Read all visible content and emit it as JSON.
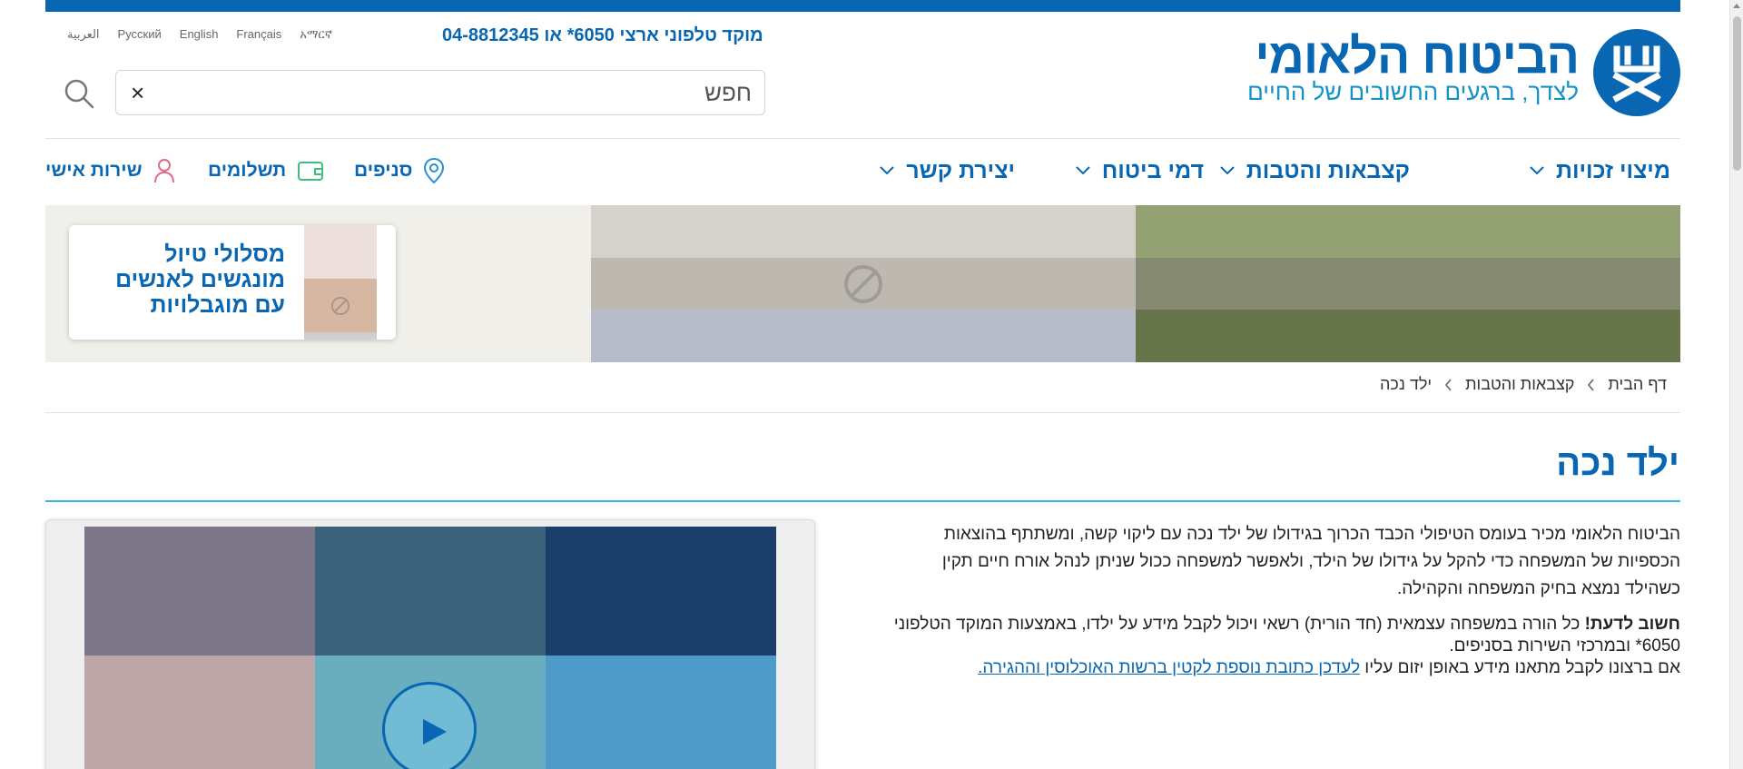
{
  "brand": {
    "title": "הביטוח הלאומי",
    "slogan": "לצדך, ברגעים החשובים של החיים",
    "color": "#0866b2"
  },
  "languages": [
    "العربية",
    "Русский",
    "English",
    "Français",
    "አማርኛ"
  ],
  "hotline": "מוקד טלפוני ארצי 6050* או 04-8812345",
  "search": {
    "placeholder": "חפש",
    "clear_label": "×"
  },
  "nav": {
    "main": [
      {
        "label": "מיצוי זכויות"
      },
      {
        "label": "קצבאות והטבות"
      },
      {
        "label": "דמי ביטוח"
      },
      {
        "label": "יצירת קשר"
      }
    ],
    "utility": [
      {
        "label": "סניפים",
        "icon": "map-pin-icon"
      },
      {
        "label": "תשלומים",
        "icon": "wallet-icon"
      },
      {
        "label": "שירות אישי",
        "icon": "user-icon"
      }
    ]
  },
  "banner": {
    "promo_lines": [
      "מסלולי טיול",
      "מונגשים לאנשים",
      "עם מוגבלויות"
    ],
    "colors": [
      "#f1efea",
      "#d5d2cb",
      "#bdb8b0",
      "#b7bccb",
      "#94a173",
      "#858a70",
      "#66754a"
    ]
  },
  "breadcrumb": [
    "דף הבית",
    "קצבאות והטבות",
    "ילד נכה"
  ],
  "page": {
    "title": "ילד נכה"
  },
  "content": {
    "p1": "הביטוח הלאומי מכיר בעומס הטיפולי הכבד הכרוך בגידולו של ילד נכה עם ליקוי קשה, ומשתתף בהוצאות הכספיות של המשפחה כדי להקל על גידולו של הילד, ולאפשר למשפחה ככול שניתן לנהל אורח חיים תקין כשהילד נמצא בחיק המשפחה והקהילה.",
    "p2_bold": "חשוב לדעת!",
    "p2_text": " כל הורה במשפחה עצמאית (חד הורית) רשאי ויכול לקבל מידע על ילדו, באמצעות המוקד הטלפוני 6050* ובמרכזי השירות בסניפים.",
    "p3_text": "אם ברצונו לקבל מתאנו מידע באופן יזום עליו ",
    "p3_link": "לעדכן כתובת נוספת לקטין ברשות האוכלוסין וההגירה."
  },
  "video": {
    "tile_colors": [
      "#1b3e6b",
      "#3c627b",
      "#7e7789",
      "#4e9ac9",
      "#68aebf",
      "#bea6a8"
    ]
  }
}
